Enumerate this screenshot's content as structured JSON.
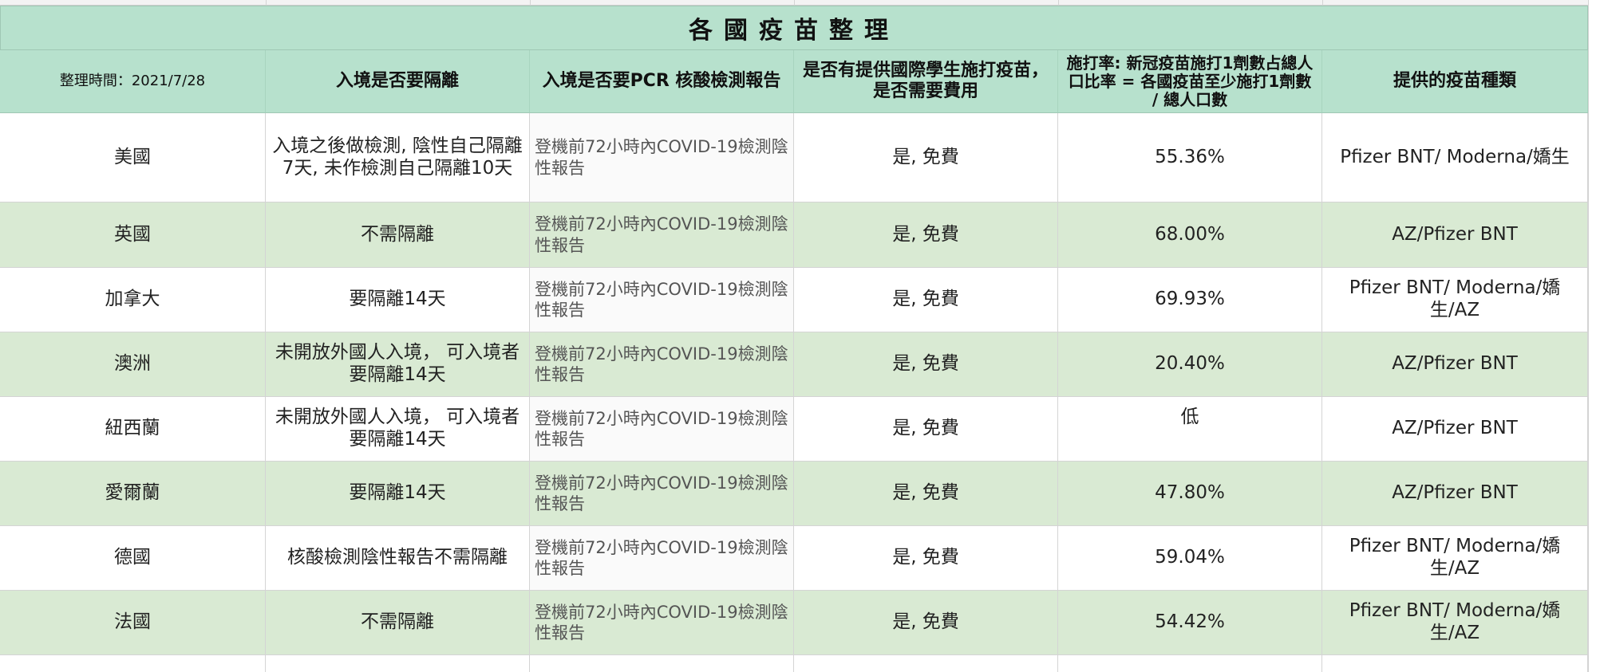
{
  "sheet": {
    "title": "各國疫苗整理",
    "headers": [
      "整理時間：2021/7/28",
      "入境是否要隔離",
      "入境是否要PCR 核酸檢測報告",
      "是否有提供國際學生施打疫苗，是否需要費用",
      "施打率: 新冠疫苗施打1劑數占總人口比率 = 各國疫苗至少施打1劑數 / 總人口數",
      "提供的疫苗種類"
    ],
    "rows": [
      [
        "美國",
        "入境之後做檢測, 陰性自己隔離7天, 未作檢測自己隔離10天",
        "登機前72小時內COVID-19檢測陰性報告",
        "是, 免費",
        "55.36%",
        "Pfizer BNT/ Moderna/嬌生"
      ],
      [
        "英國",
        "不需隔離",
        "登機前72小時內COVID-19檢測陰性報告",
        "是, 免費",
        "68.00%",
        "AZ/Pfizer BNT"
      ],
      [
        "加拿大",
        "要隔離14天",
        "登機前72小時內COVID-19檢測陰性報告",
        "是, 免費",
        "69.93%",
        "Pfizer BNT/ Moderna/嬌生/AZ"
      ],
      [
        "澳洲",
        "未開放外國人入境， 可入境者要隔離14天",
        "登機前72小時內COVID-19檢測陰性報告",
        "是, 免費",
        "20.40%",
        "AZ/Pfizer BNT"
      ],
      [
        "紐西蘭",
        "未開放外國人入境， 可入境者要隔離14天",
        "登機前72小時內COVID-19檢測陰性報告",
        "是, 免費",
        "低",
        "AZ/Pfizer BNT"
      ],
      [
        "愛爾蘭",
        "要隔離14天",
        "登機前72小時內COVID-19檢測陰性報告",
        "是, 免費",
        "47.80%",
        "AZ/Pfizer BNT"
      ],
      [
        "德國",
        "核酸檢測陰性報告不需隔離",
        "登機前72小時內COVID-19檢測陰性報告",
        "是, 免費",
        "59.04%",
        "Pfizer BNT/ Moderna/嬌生/AZ"
      ],
      [
        "法國",
        "不需隔離",
        "登機前72小時內COVID-19檢測陰性報告",
        "是, 免費",
        "54.42%",
        "Pfizer BNT/ Moderna/嬌生/AZ"
      ]
    ]
  },
  "colors": {
    "header_bg": "#b7e1cd",
    "band_bg": "#d9ead3",
    "grid": "#d4d4d4"
  }
}
